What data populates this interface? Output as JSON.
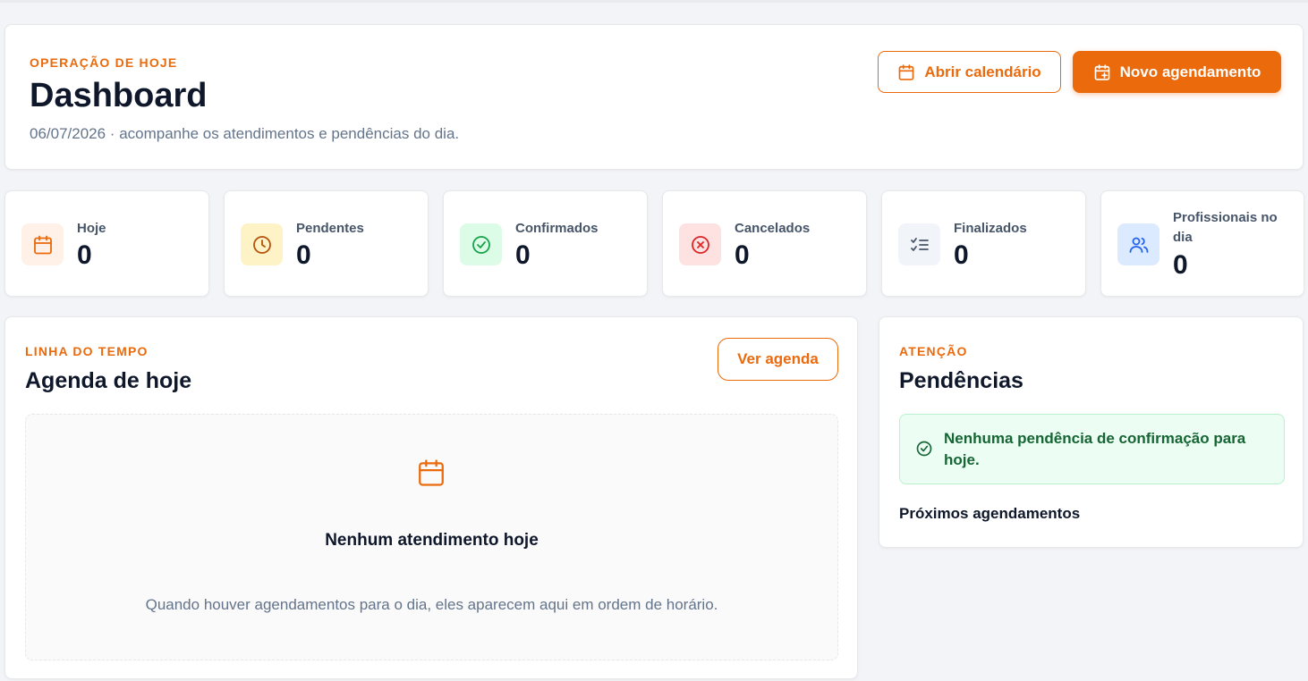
{
  "header": {
    "eyebrow": "OPERAÇÃO DE HOJE",
    "title": "Dashboard",
    "subtitle": "06/07/2026 · acompanhe os atendimentos e pendências do dia.",
    "open_calendar_label": "Abrir calendário",
    "new_appointment_label": "Novo agendamento"
  },
  "stats": [
    {
      "label": "Hoje",
      "value": "0",
      "icon": "calendar-icon",
      "color": "#ea6a0c",
      "bg": "#fff1e7"
    },
    {
      "label": "Pendentes",
      "value": "0",
      "icon": "clock-icon",
      "color": "#b45309",
      "bg": "#fef3c7"
    },
    {
      "label": "Confirmados",
      "value": "0",
      "icon": "check-circle-icon",
      "color": "#16a34a",
      "bg": "#dcfce7"
    },
    {
      "label": "Cancelados",
      "value": "0",
      "icon": "x-circle-icon",
      "color": "#dc2626",
      "bg": "#fee2e2"
    },
    {
      "label": "Finalizados",
      "value": "0",
      "icon": "list-checks-icon",
      "color": "#475569",
      "bg": "#f1f5f9"
    },
    {
      "label": "Profissionais no dia",
      "value": "0",
      "icon": "users-icon",
      "color": "#2563eb",
      "bg": "#dbeafe"
    }
  ],
  "agenda": {
    "eyebrow": "LINHA DO TEMPO",
    "title": "Agenda de hoje",
    "view_label": "Ver agenda",
    "empty_title": "Nenhum atendimento hoje",
    "empty_desc": "Quando houver agendamentos para o dia, eles aparecem aqui em ordem de horário."
  },
  "pendencias": {
    "eyebrow": "ATENÇÃO",
    "title": "Pendências",
    "notice": "Nenhuma pendência de confirmação para hoje.",
    "next_title": "Próximos agendamentos"
  },
  "colors": {
    "accent": "#ea6a0c",
    "success_text": "#166534",
    "success_bg": "#ecfdf3"
  }
}
